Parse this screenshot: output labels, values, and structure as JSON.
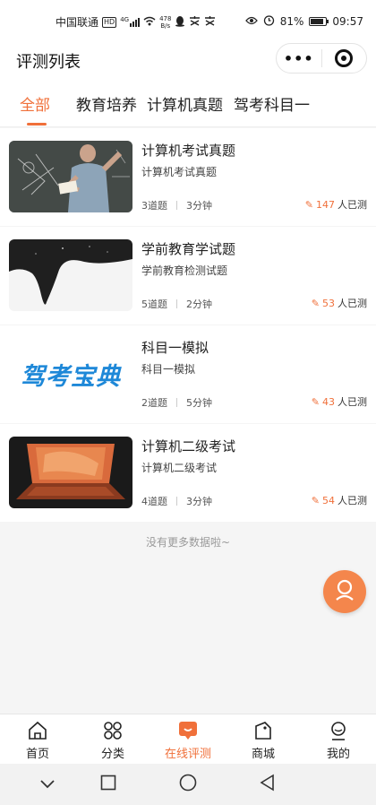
{
  "status_bar": {
    "carrier": "中国联通",
    "hd": "HD",
    "signal": "4G",
    "net_speed_value": "478",
    "net_speed_unit": "B/s",
    "battery_percent": "81%",
    "time": "09:57"
  },
  "header": {
    "title": "评测列表",
    "more_icon": "more-dots-icon",
    "close_icon": "target-icon"
  },
  "tabs": [
    {
      "label": "全部",
      "active": true
    },
    {
      "label": "教育培养",
      "active": false
    },
    {
      "label": "计算机真题",
      "active": false
    },
    {
      "label": "驾考科目一",
      "active": false
    }
  ],
  "list": [
    {
      "title": "计算机考试真题",
      "subtitle": "计算机考试真题",
      "questions": "3道题",
      "duration": "3分钟",
      "count": "147",
      "count_label": "人已测",
      "thumb": "teacher-chalkboard-image"
    },
    {
      "title": "学前教育学试题",
      "subtitle": "学前教育检测试题",
      "questions": "5道题",
      "duration": "2分钟",
      "count": "53",
      "count_label": "人已测",
      "thumb": "ink-splash-image"
    },
    {
      "title": "科目一模拟",
      "subtitle": "科目一模拟",
      "questions": "2道题",
      "duration": "5分钟",
      "count": "43",
      "count_label": "人已测",
      "thumb": "jiakao-baodian-logo",
      "thumb_text": "驾考宝典"
    },
    {
      "title": "计算机二级考试",
      "subtitle": "计算机二级考试",
      "questions": "4道题",
      "duration": "3分钟",
      "count": "54",
      "count_label": "人已测",
      "thumb": "laptop-image"
    }
  ],
  "no_more_text": "没有更多数据啦~",
  "fab_icon": "user-service-icon",
  "tabbar": [
    {
      "label": "首页",
      "icon": "home-icon",
      "active": false
    },
    {
      "label": "分类",
      "icon": "category-icon",
      "active": false
    },
    {
      "label": "在线评测",
      "icon": "online-test-icon",
      "active": true
    },
    {
      "label": "商城",
      "icon": "shop-icon",
      "active": false
    },
    {
      "label": "我的",
      "icon": "profile-icon",
      "active": false
    }
  ],
  "colors": {
    "accent": "#f0703a",
    "fab": "#f4864c",
    "logo_blue": "#1e88d8"
  }
}
